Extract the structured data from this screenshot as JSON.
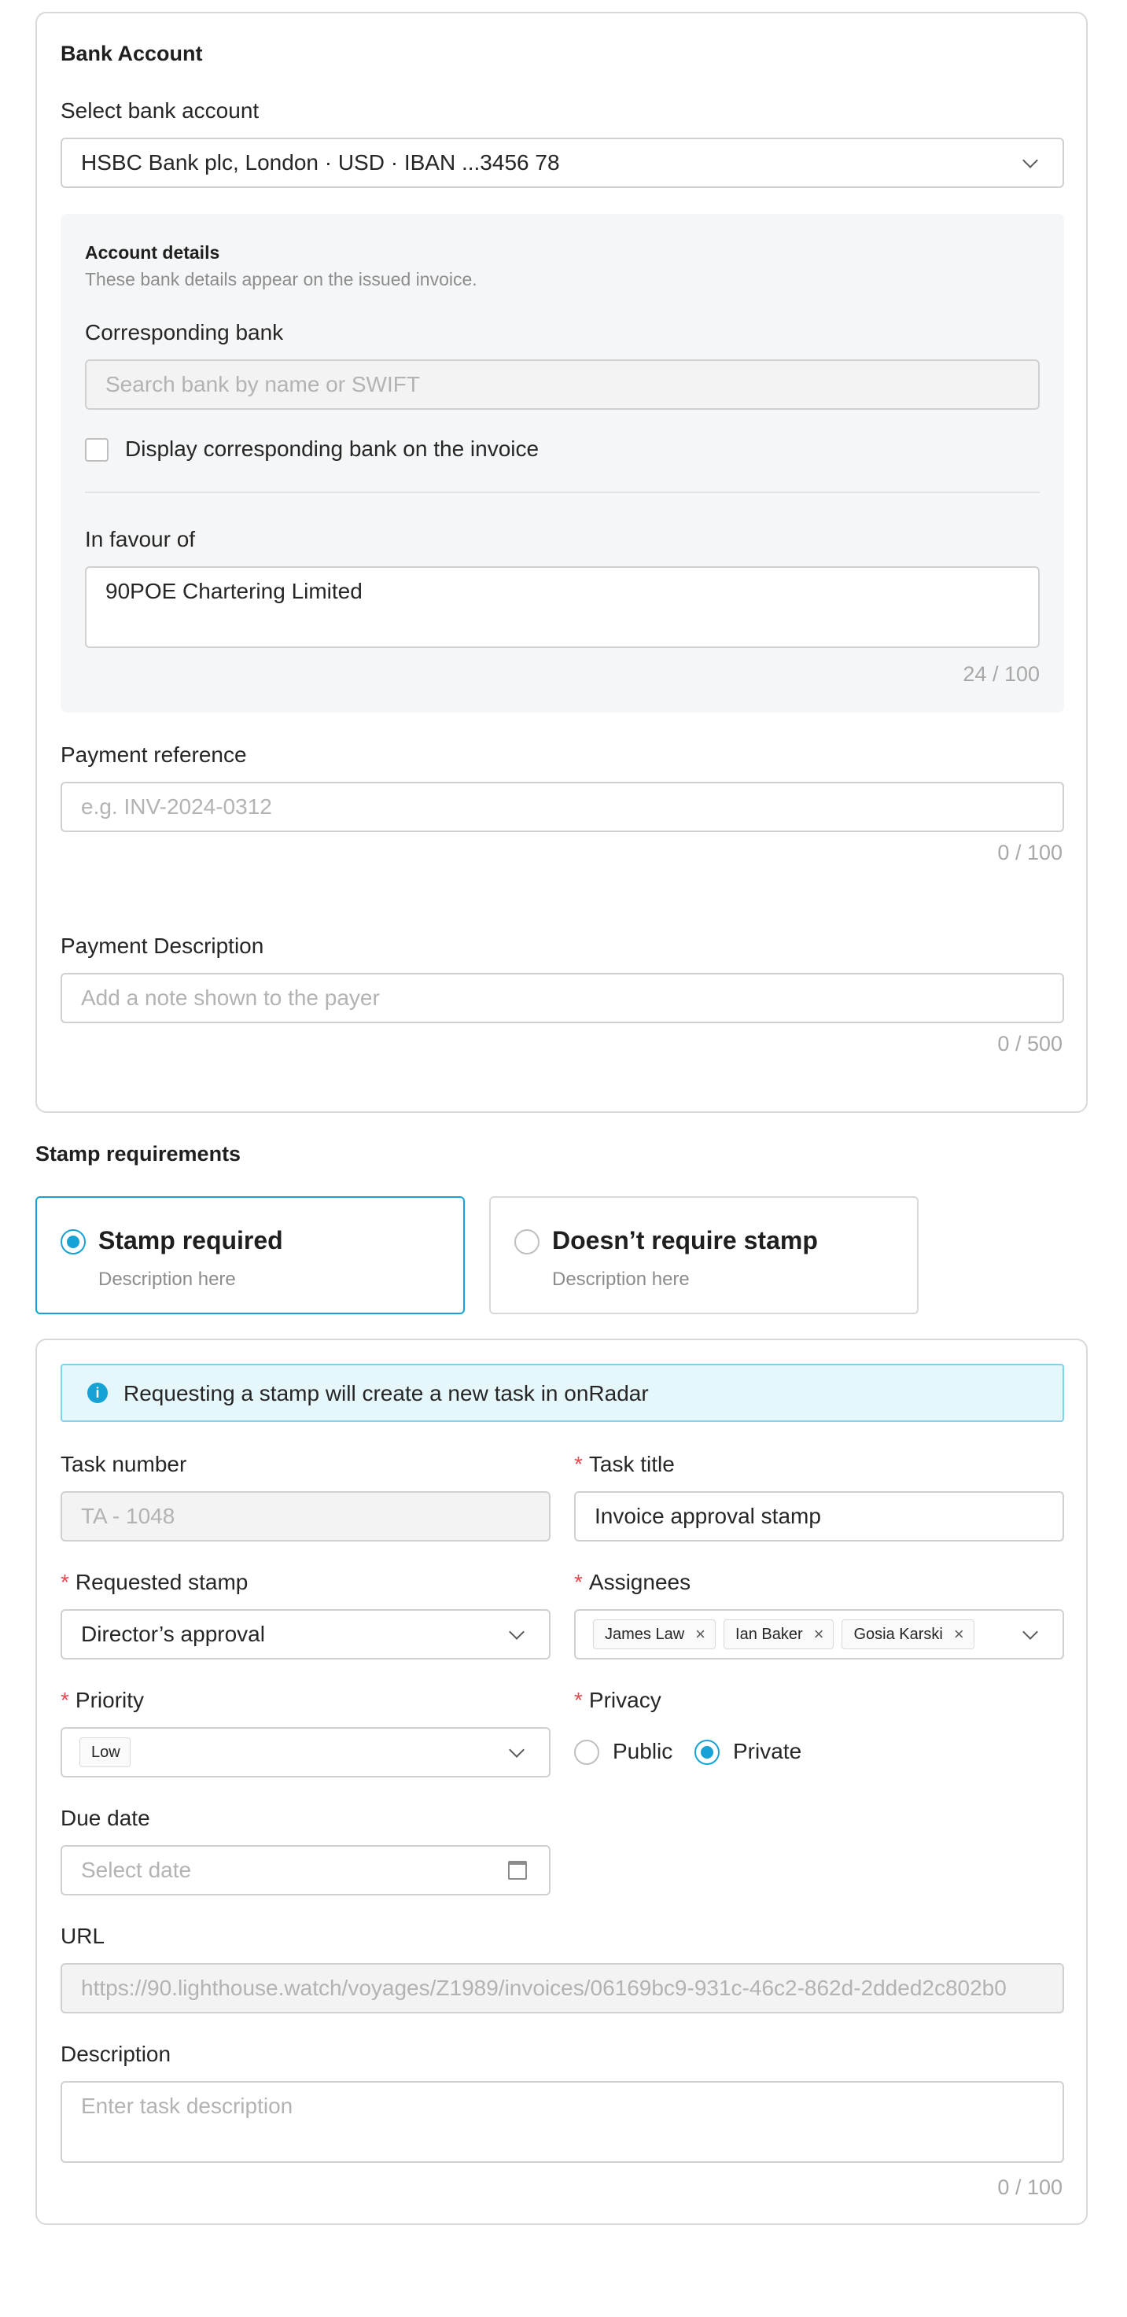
{
  "bank": {
    "title": "Bank Account",
    "select_label": "Select bank account",
    "selected_account": "HSBC Bank plc, London · USD · IBAN ...3456 78",
    "details": {
      "title": "Account details",
      "subtitle": "These bank details appear on the issued invoice.",
      "corresponding_label": "Corresponding bank",
      "corresponding_placeholder": "Search bank by name or SWIFT",
      "display_checkbox_label": "Display corresponding bank on the invoice",
      "in_favour_label": "In favour of",
      "in_favour_value": "90POE Chartering Limited",
      "in_favour_counter": "24 / 100"
    },
    "payment_reference_label": "Payment reference",
    "payment_reference_placeholder": "e.g. INV-2024-0312",
    "payment_reference_counter": "0 / 100",
    "payment_description_label": "Payment Description",
    "payment_description_placeholder": "Add a note shown to the payer",
    "payment_description_counter": "0 / 500"
  },
  "stamp": {
    "title": "Stamp requirements",
    "options": [
      {
        "title": "Stamp required",
        "desc": "Description here",
        "selected": true
      },
      {
        "title": "Doesn’t require stamp",
        "desc": "Description here",
        "selected": false
      }
    ],
    "info_text": "Requesting a stamp will create a new task in onRadar",
    "info_icon": "info-icon",
    "task_number_label": "Task number",
    "task_number_value": "TA - 1048",
    "task_title_label": "Task title",
    "task_title_value": "Invoice approval stamp",
    "requested_stamp_label": "Requested stamp",
    "requested_stamp_value": "Director’s approval",
    "assignees_label": "Assignees",
    "assignees": [
      "James Law",
      "Ian Baker",
      "Gosia Karski"
    ],
    "priority_label": "Priority",
    "priority_value": "Low",
    "privacy_label": "Privacy",
    "privacy_options": [
      "Public",
      "Private"
    ],
    "privacy_selected": "Private",
    "due_date_label": "Due date",
    "due_date_placeholder": "Select date",
    "url_label": "URL",
    "url_value": "https://90.lighthouse.watch/voyages/Z1989/invoices/06169bc9-931c-46c2-862d-2dded2c802b0",
    "description_label": "Description",
    "description_placeholder": "Enter task description",
    "description_counter": "0 / 100",
    "required_mark": "*"
  },
  "colors": {
    "accent": "#16a2d4",
    "required": "#e5484d",
    "info_bg": "#e6f7fc",
    "info_border": "#7fd3ec"
  }
}
